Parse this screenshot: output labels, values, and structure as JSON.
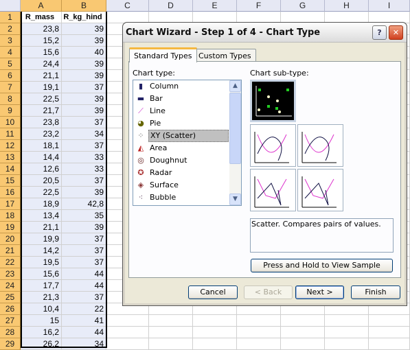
{
  "sheet": {
    "columns": [
      "A",
      "B",
      "C",
      "D",
      "E",
      "F",
      "G",
      "H",
      "I"
    ],
    "headers": [
      "R_mass",
      "R_kg_hind"
    ],
    "rows": [
      [
        "23,8",
        "39"
      ],
      [
        "15,2",
        "39"
      ],
      [
        "15,6",
        "40"
      ],
      [
        "24,4",
        "39"
      ],
      [
        "21,1",
        "39"
      ],
      [
        "19,1",
        "37"
      ],
      [
        "22,5",
        "39"
      ],
      [
        "21,7",
        "39"
      ],
      [
        "23,8",
        "37"
      ],
      [
        "23,2",
        "34"
      ],
      [
        "18,1",
        "37"
      ],
      [
        "14,4",
        "33"
      ],
      [
        "12,6",
        "33"
      ],
      [
        "20,5",
        "37"
      ],
      [
        "22,5",
        "39"
      ],
      [
        "18,9",
        "42,8"
      ],
      [
        "13,4",
        "35"
      ],
      [
        "21,1",
        "39"
      ],
      [
        "19,9",
        "37"
      ],
      [
        "14,2",
        "37"
      ],
      [
        "19,5",
        "37"
      ],
      [
        "15,6",
        "44"
      ],
      [
        "17,7",
        "44"
      ],
      [
        "21,3",
        "37"
      ],
      [
        "10,4",
        "22"
      ],
      [
        "15",
        "41"
      ],
      [
        "16,2",
        "44"
      ],
      [
        "26,2",
        "34"
      ]
    ],
    "row_numbers": [
      "1",
      "2",
      "3",
      "4",
      "5",
      "6",
      "7",
      "8",
      "9",
      "10",
      "11",
      "12",
      "13",
      "14",
      "15",
      "16",
      "17",
      "18",
      "19",
      "20",
      "21",
      "22",
      "23",
      "24",
      "25",
      "26",
      "27",
      "28",
      "29"
    ]
  },
  "dialog": {
    "title": "Chart Wizard - Step 1 of 4 - Chart Type",
    "help": "?",
    "close": "✕",
    "tabs": [
      {
        "label": "Standard Types",
        "active": true
      },
      {
        "label": "Custom Types",
        "active": false
      }
    ],
    "chart_type_label": "Chart type:",
    "chart_types": [
      {
        "label": "Column",
        "icon": "column-chart-icon"
      },
      {
        "label": "Bar",
        "icon": "bar-chart-icon"
      },
      {
        "label": "Line",
        "icon": "line-chart-icon"
      },
      {
        "label": "Pie",
        "icon": "pie-chart-icon"
      },
      {
        "label": "XY (Scatter)",
        "icon": "scatter-chart-icon",
        "selected": true
      },
      {
        "label": "Area",
        "icon": "area-chart-icon"
      },
      {
        "label": "Doughnut",
        "icon": "doughnut-chart-icon"
      },
      {
        "label": "Radar",
        "icon": "radar-chart-icon"
      },
      {
        "label": "Surface",
        "icon": "surface-chart-icon"
      },
      {
        "label": "Bubble",
        "icon": "bubble-chart-icon"
      }
    ],
    "subtype_label": "Chart sub-type:",
    "description": "Scatter. Compares pairs of values.",
    "sample_button": "Press and Hold to View Sample",
    "buttons": {
      "cancel": "Cancel",
      "back": "< Back",
      "next": "Next >",
      "finish": "Finish"
    }
  }
}
